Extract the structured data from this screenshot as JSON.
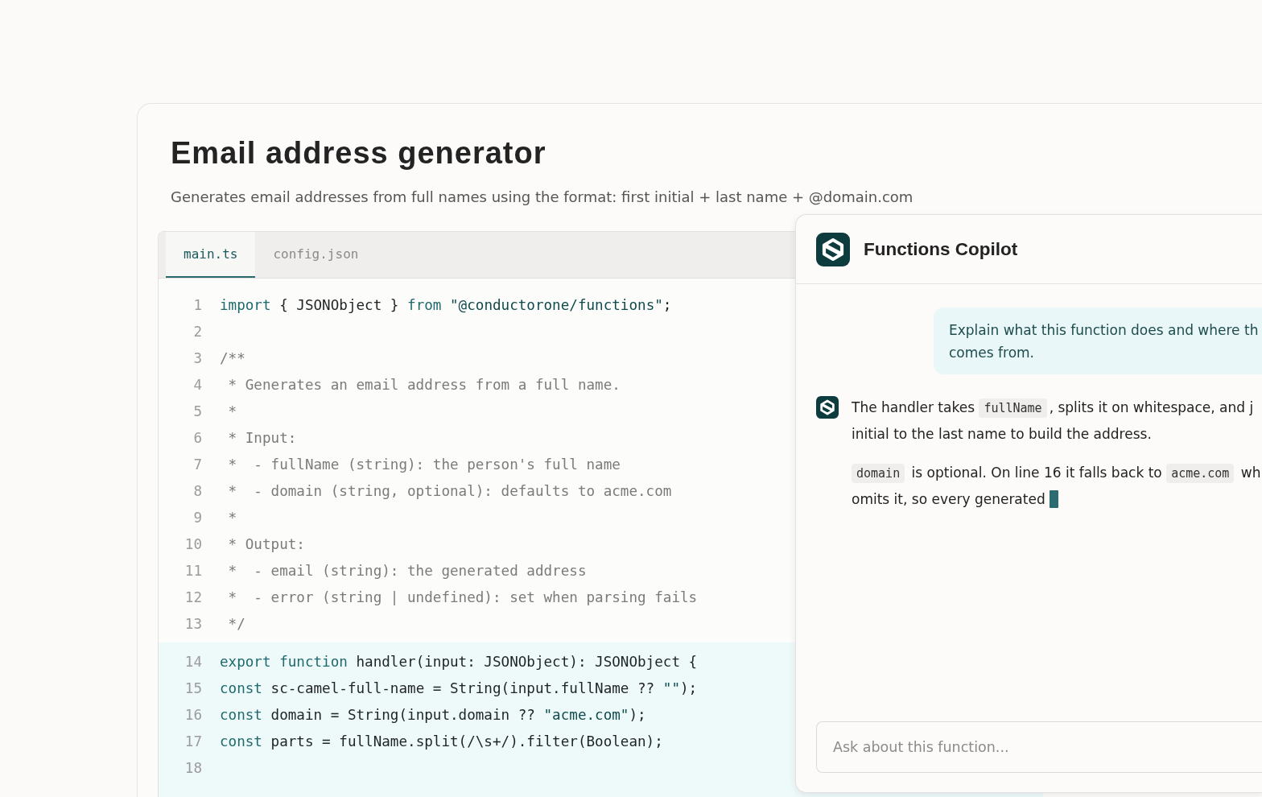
{
  "page": {
    "title": "Email address generator",
    "description": "Generates email addresses from full names using the format: first initial + last name + @domain.com"
  },
  "editor": {
    "tabs": [
      {
        "label": "main.ts",
        "selected": true
      },
      {
        "label": "config.json",
        "selected": false
      }
    ],
    "lines": [
      {
        "number": "1",
        "highlighted": false,
        "tokens": [
          {
            "kind": "keyword",
            "text": "import"
          },
          {
            "kind": "plain",
            "text": " { JSONObject } "
          },
          {
            "kind": "keyword",
            "text": "from"
          },
          {
            "kind": "string",
            "text": " \"@conductorone/functions\""
          },
          {
            "kind": "plain",
            "text": ";"
          }
        ]
      },
      {
        "number": "2",
        "highlighted": false
      },
      {
        "number": "3",
        "highlighted": false,
        "tokens": [
          {
            "kind": "comment",
            "text": "/**"
          }
        ]
      },
      {
        "number": "4",
        "highlighted": false,
        "tokens": [
          {
            "kind": "comment",
            "text": " * Generates an email address from a full name."
          }
        ]
      },
      {
        "number": "5",
        "highlighted": false,
        "tokens": [
          {
            "kind": "comment",
            "text": " *"
          }
        ]
      },
      {
        "number": "6",
        "highlighted": false,
        "tokens": [
          {
            "kind": "comment",
            "text": " * Input:"
          }
        ]
      },
      {
        "number": "7",
        "highlighted": false,
        "tokens": [
          {
            "kind": "comment",
            "text": " *  - fullName (string): the person's full name"
          }
        ]
      },
      {
        "number": "8",
        "highlighted": false,
        "tokens": [
          {
            "kind": "comment",
            "text": " *  - domain (string, optional): defaults to acme.com"
          }
        ]
      },
      {
        "number": "9",
        "highlighted": false,
        "tokens": [
          {
            "kind": "comment",
            "text": " *"
          }
        ]
      },
      {
        "number": "10",
        "highlighted": false,
        "tokens": [
          {
            "kind": "comment",
            "text": " * Output:"
          }
        ]
      },
      {
        "number": "11",
        "highlighted": false,
        "tokens": [
          {
            "kind": "comment",
            "text": " *  - email (string): the generated address"
          }
        ]
      },
      {
        "number": "12",
        "highlighted": false,
        "tokens": [
          {
            "kind": "comment",
            "text": " *  - error (string | undefined): set when parsing fails"
          }
        ]
      },
      {
        "number": "13",
        "highlighted": false,
        "tokens": [
          {
            "kind": "comment",
            "text": " */"
          }
        ]
      },
      {
        "number": "14",
        "highlighted": true,
        "tokens": [
          {
            "kind": "keyword",
            "text": "export function"
          },
          {
            "kind": "plain",
            "text": " handler(input: JSONObject): JSONObject {"
          }
        ]
      },
      {
        "number": "15",
        "highlighted": true,
        "tokens": [
          {
            "kind": "keyword",
            "text": "const"
          },
          {
            "kind": "plain",
            "text": " sc-camel-full-name = String(input.fullName ?? "
          },
          {
            "kind": "string",
            "text": "\"\""
          },
          {
            "kind": "plain",
            "text": ");"
          }
        ]
      },
      {
        "number": "16",
        "highlighted": true,
        "tokens": [
          {
            "kind": "keyword",
            "text": "const"
          },
          {
            "kind": "plain",
            "text": " domain = String(input.domain ?? "
          },
          {
            "kind": "string",
            "text": "\"acme.com\""
          },
          {
            "kind": "plain",
            "text": ");"
          }
        ]
      },
      {
        "number": "17",
        "highlighted": true,
        "tokens": [
          {
            "kind": "keyword",
            "text": "const"
          },
          {
            "kind": "plain",
            "text": " parts = fullName.split(/\\s+/).filter(Boolean);"
          }
        ]
      },
      {
        "number": "18",
        "highlighted": true
      }
    ]
  },
  "copilot": {
    "title": "Functions Copilot",
    "messages": [
      {
        "kind": "user",
        "paragraphs": [
          [
            [
              {
                "kind": "text",
                "text": "Explain what this function does and where th"
              }
            ],
            [
              {
                "kind": "text",
                "text": "comes from."
              }
            ]
          ]
        ]
      },
      {
        "kind": "assistant",
        "streaming": true,
        "paragraphs": [
          [
            [
              {
                "kind": "text",
                "text": "The handler takes "
              },
              {
                "kind": "code",
                "text": "fullName"
              },
              {
                "kind": "text",
                "text": ", splits it on whitespace, and j"
              }
            ],
            [
              {
                "kind": "text",
                "text": "initial to the last name to build the address."
              }
            ]
          ],
          [
            [
              {
                "kind": "code",
                "text": "domain"
              },
              {
                "kind": "text",
                "text": " is optional. On line 16 it falls back to "
              },
              {
                "kind": "code",
                "text": "acme.com"
              },
              {
                "kind": "text",
                "text": " wh"
              }
            ],
            [
              {
                "kind": "text",
                "text": "omits it, so every generated"
              }
            ]
          ]
        ]
      }
    ],
    "input": {
      "placeholder": "Ask about this function..."
    }
  }
}
